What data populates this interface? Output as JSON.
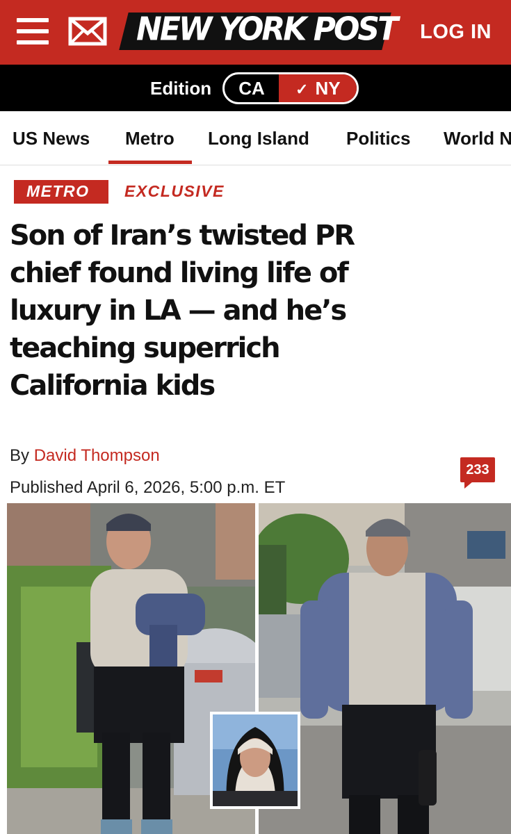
{
  "header": {
    "logo_text": "NEW YORK POST",
    "login_label": "LOG IN",
    "menu_icon": "hamburger-menu-icon",
    "mail_icon": "envelope-icon",
    "brand_color": "#c42a21"
  },
  "edition": {
    "label": "Edition",
    "options": [
      "CA",
      "NY"
    ],
    "selected": "NY"
  },
  "sections": {
    "items": [
      "US News",
      "Metro",
      "Long Island",
      "Politics",
      "World N"
    ],
    "active": "Metro"
  },
  "article": {
    "section_tag": "METRO",
    "kicker": "EXCLUSIVE",
    "headline_lines": [
      "Son of Iran’s twisted PR",
      "chief found living life of",
      "luxury in LA — and he’s",
      "teaching superrich",
      "California kids"
    ],
    "byline_prefix": "By",
    "author": "David Thompson",
    "published": "Published April 6, 2026, 5:00 p.m. ET",
    "comment_count": "233"
  }
}
